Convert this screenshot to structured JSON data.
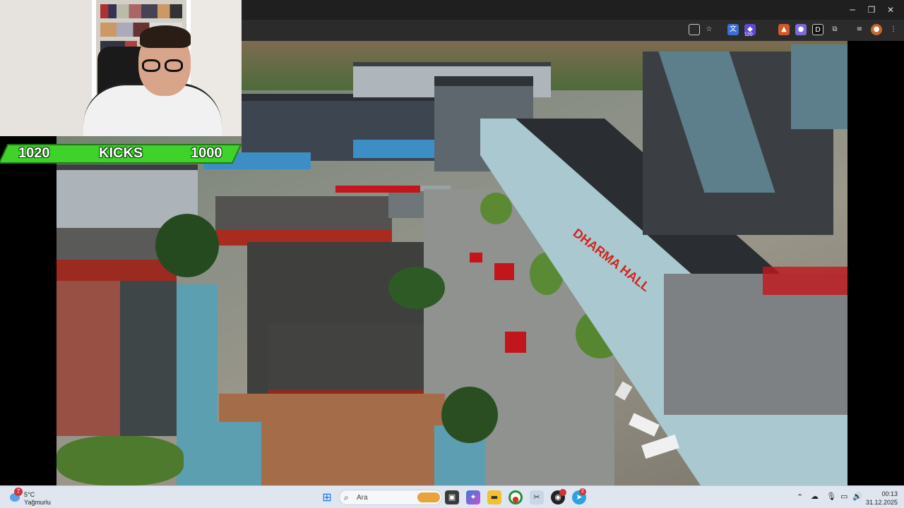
{
  "overlay": {
    "left_count": "1020",
    "title": "KICKS",
    "right_count": "1000"
  },
  "video": {
    "sign_text": "DHARMA HALL"
  },
  "browser": {
    "extension_badge": "120",
    "icons": [
      "window-icon",
      "star-icon",
      "translate-icon",
      "shield-icon",
      "flame-icon",
      "ext-icon",
      "d-icon",
      "puzzle-icon",
      "playlist-icon",
      "profile-icon",
      "menu-icon"
    ]
  },
  "taskbar": {
    "weather_badge": "7",
    "weather_temp": "5°C",
    "weather_desc": "Yağmurlu",
    "search_placeholder": "Ara",
    "app_badge": "2",
    "time": "00:13",
    "date": "31.12.2025"
  },
  "colors": {
    "overlay_green": "#3fd22b",
    "roof_teal": "#5aa6b5",
    "wall_red": "#b52a1e",
    "taskbar_bg": "#dfe6ef"
  }
}
